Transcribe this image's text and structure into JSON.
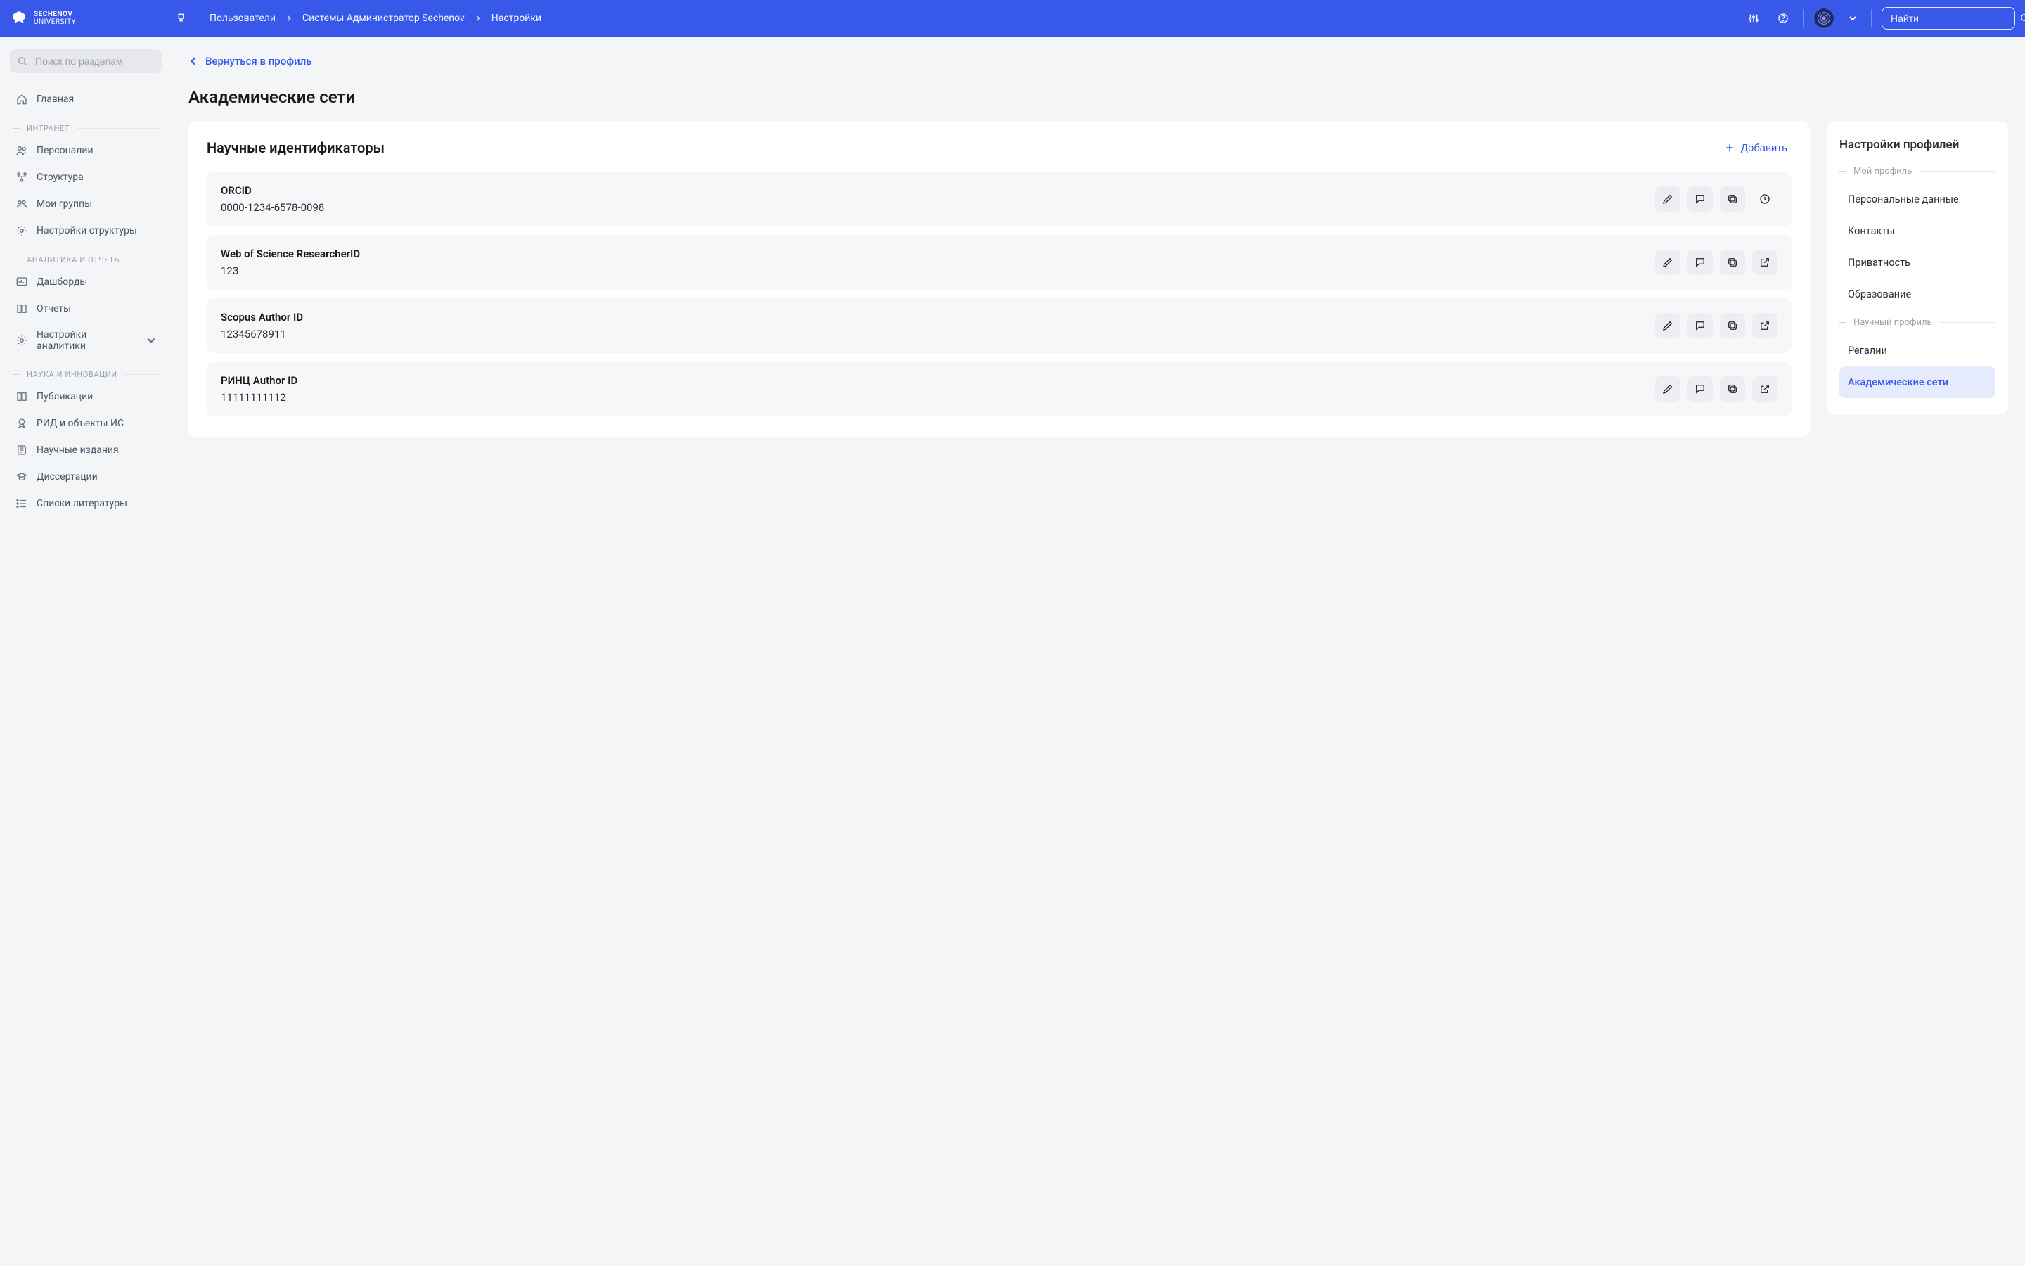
{
  "brand": {
    "line1": "SECHENOV",
    "line2": "UNIVERSITY"
  },
  "breadcrumb": [
    "Пользователи",
    "Системы Администратор Sechenov",
    "Настройки"
  ],
  "search_placeholder": "Найти",
  "sidebar": {
    "search_placeholder": "Поиск по разделам",
    "top": [
      {
        "label": "Главная",
        "icon": "home"
      }
    ],
    "sections": [
      {
        "title": "ИНТРАНЕТ",
        "items": [
          {
            "label": "Персоналии",
            "icon": "users"
          },
          {
            "label": "Структура",
            "icon": "tree"
          },
          {
            "label": "Мои группы",
            "icon": "groups"
          },
          {
            "label": "Настройки структуры",
            "icon": "gear"
          }
        ]
      },
      {
        "title": "АНАЛИТИКА И ОТЧЕТЫ",
        "items": [
          {
            "label": "Дашборды",
            "icon": "dashboard"
          },
          {
            "label": "Отчеты",
            "icon": "book"
          },
          {
            "label": "Настройки аналитики",
            "icon": "gear",
            "expandable": true
          }
        ]
      },
      {
        "title": "НАУКА И ИННОВАЦИИ",
        "items": [
          {
            "label": "Публикации",
            "icon": "book"
          },
          {
            "label": "РИД и объекты ИС",
            "icon": "award"
          },
          {
            "label": "Научные издания",
            "icon": "journal"
          },
          {
            "label": "Диссертации",
            "icon": "cap"
          },
          {
            "label": "Списки литературы",
            "icon": "list"
          }
        ]
      }
    ]
  },
  "back_label": "Вернуться в профиль",
  "page_title": "Академические сети",
  "identifiers_card": {
    "title": "Научные идентификаторы",
    "add_label": "Добавить",
    "rows": [
      {
        "label": "ORCID",
        "value": "0000-1234-6578-0098",
        "trailing": "history"
      },
      {
        "label": "Web of Science ResearcherID",
        "value": "123",
        "trailing": "external"
      },
      {
        "label": "Scopus Author ID",
        "value": "12345678911",
        "trailing": "external"
      },
      {
        "label": "РИНЦ Author ID",
        "value": "11111111112",
        "trailing": "external"
      }
    ]
  },
  "settings_panel": {
    "title": "Настройки профилей",
    "sections": [
      {
        "title": "Мой профиль",
        "items": [
          {
            "label": "Персональные данные"
          },
          {
            "label": "Контакты"
          },
          {
            "label": "Приватность"
          },
          {
            "label": "Образование"
          }
        ]
      },
      {
        "title": "Научный профиль",
        "items": [
          {
            "label": "Регалии"
          },
          {
            "label": "Академические сети",
            "active": true
          }
        ]
      }
    ]
  }
}
